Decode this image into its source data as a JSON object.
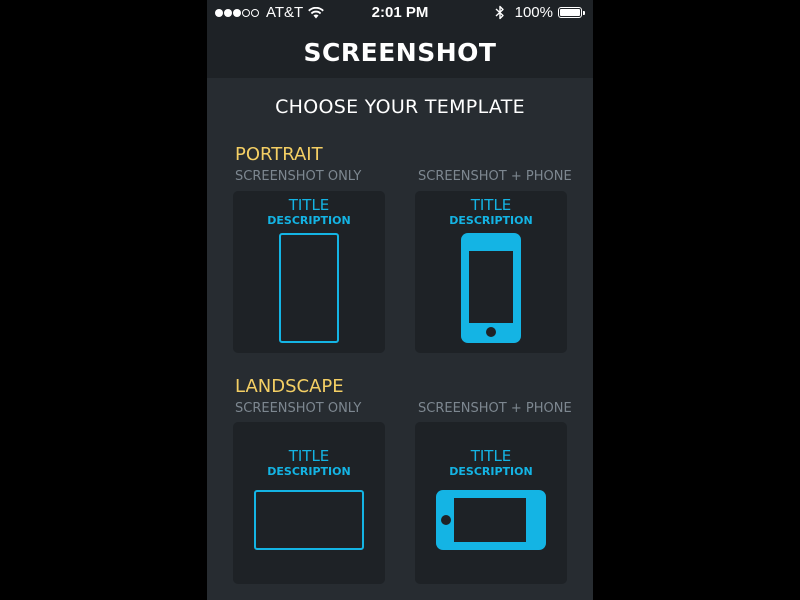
{
  "status_bar": {
    "carrier": "AT&T",
    "time": "2:01 PM",
    "battery": "100%",
    "icons": [
      "signal-dots-icon",
      "wifi-icon",
      "bluetooth-icon",
      "battery-icon"
    ]
  },
  "nav": {
    "title": "SCREENSHOT"
  },
  "heading": "CHOOSE YOUR TEMPLATE",
  "colors": {
    "accent": "#14b4e4",
    "section": "#f4cf64",
    "muted": "#7d8790",
    "background": "#272c31",
    "card": "#1e2226"
  },
  "sections": [
    {
      "label": "PORTRAIT",
      "options": [
        {
          "caption": "SCREENSHOT ONLY",
          "title": "TITLE",
          "description": "DESCRIPTION",
          "icon": "portrait-screen-outline-icon"
        },
        {
          "caption": "SCREENSHOT + PHONE",
          "title": "TITLE",
          "description": "DESCRIPTION",
          "icon": "portrait-phone-icon"
        }
      ]
    },
    {
      "label": "LANDSCAPE",
      "options": [
        {
          "caption": "SCREENSHOT ONLY",
          "title": "TITLE",
          "description": "DESCRIPTION",
          "icon": "landscape-screen-outline-icon"
        },
        {
          "caption": "SCREENSHOT + PHONE",
          "title": "TITLE",
          "description": "DESCRIPTION",
          "icon": "landscape-phone-icon"
        }
      ]
    }
  ]
}
